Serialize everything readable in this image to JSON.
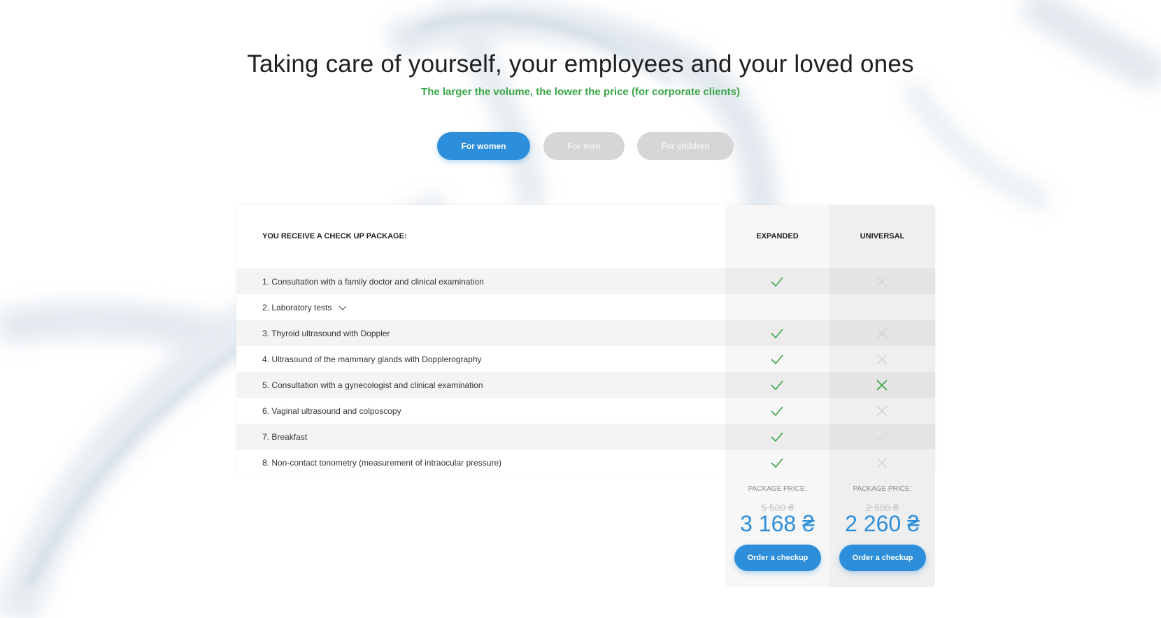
{
  "header": {
    "title": "Taking care of yourself, your employees and your loved ones",
    "subtitle": "The larger the volume, the lower the price (for corporate clients)"
  },
  "tabs": [
    {
      "label": "For women",
      "active": true
    },
    {
      "label": "For men",
      "active": false
    },
    {
      "label": "For children",
      "active": false
    }
  ],
  "table": {
    "heading": "YOU RECEIVE A CHECK UP PACKAGE:",
    "columns": [
      "EXPANDED",
      "UNIVERSAL"
    ],
    "rows": [
      {
        "label": "1. Consultation with a family doctor and clinical examination",
        "expanded": "check",
        "universal": "cross-faded"
      },
      {
        "label": "2.  Laboratory tests",
        "expanded": "none",
        "universal": "none",
        "expandable": true
      },
      {
        "label": "3. Thyroid ultrasound with Doppler",
        "expanded": "check",
        "universal": "cross-faded"
      },
      {
        "label": "4. Ultrasound of the mammary glands with Dopplerography",
        "expanded": "check",
        "universal": "cross-faded"
      },
      {
        "label": "5. Consultation with a gynecologist and clinical examination",
        "expanded": "check",
        "universal": "cross-green"
      },
      {
        "label": "6. Vaginal ultrasound and colposcopy",
        "expanded": "check",
        "universal": "cross-faded"
      },
      {
        "label": "7. Breakfast",
        "expanded": "check",
        "universal": "check-faded"
      },
      {
        "label": "8. Non-contact tonometry (measurement of intraocular pressure)",
        "expanded": "check",
        "universal": "cross-faded"
      }
    ]
  },
  "pricing": {
    "expanded": {
      "label": "PACKAGE PRICE:",
      "old_price": "5 500 ₴",
      "price": "3 168 ₴",
      "button": "Order a checkup"
    },
    "universal": {
      "label": "PACKAGE PRICE:",
      "old_price": "2 500 ₴",
      "price": "2 260 ₴",
      "button": "Order a checkup"
    }
  },
  "colors": {
    "accent_blue": "#2d8fdb",
    "check_green": "#3aa647",
    "subtitle_green": "#3aa647",
    "faded_mark": "#cfcfcf",
    "inactive_tab": "#d6d6d6"
  }
}
